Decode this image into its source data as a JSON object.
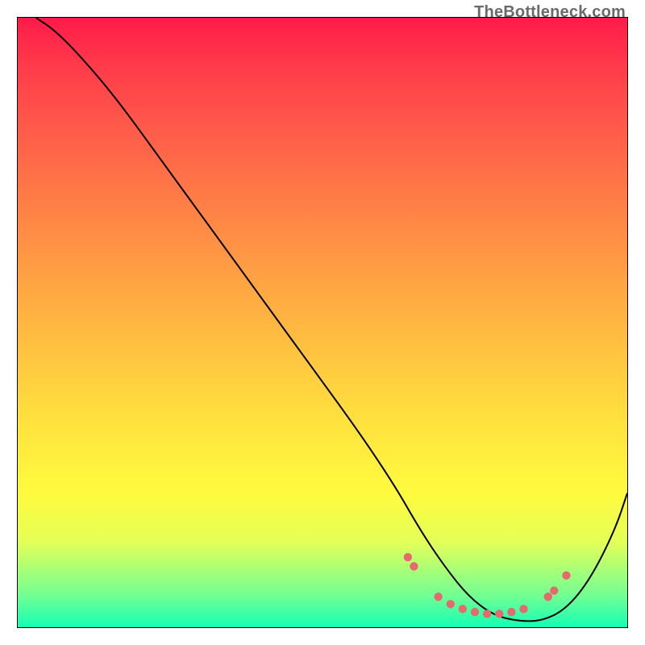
{
  "watermark": "TheBottleneck.com",
  "chart_data": {
    "type": "line",
    "title": "",
    "xlabel": "",
    "ylabel": "",
    "xlim": [
      0,
      100
    ],
    "ylim": [
      0,
      100
    ],
    "grid": false,
    "legend": false,
    "background_gradient": {
      "direction": "vertical",
      "stops": [
        {
          "pos": 0.0,
          "color": "#ff1a49"
        },
        {
          "pos": 0.5,
          "color": "#ffc140"
        },
        {
          "pos": 1.0,
          "color": "#13ffb4"
        }
      ]
    },
    "series": [
      {
        "name": "bottleneck-curve",
        "x": [
          3,
          6,
          10,
          16,
          24,
          32,
          40,
          48,
          56,
          62,
          66,
          70,
          74,
          78,
          82,
          86,
          90,
          94,
          98,
          100
        ],
        "y": [
          100,
          98,
          94,
          87,
          76,
          65,
          54,
          43,
          32,
          23,
          16,
          10,
          5,
          2,
          1,
          1,
          3,
          8,
          16,
          22
        ]
      }
    ],
    "highlight_dots": {
      "name": "minimum-region",
      "color": "#e46a6e",
      "points": [
        {
          "x": 64,
          "y": 11.5
        },
        {
          "x": 65,
          "y": 10.0
        },
        {
          "x": 69,
          "y": 5.0
        },
        {
          "x": 71,
          "y": 3.8
        },
        {
          "x": 73,
          "y": 3.0
        },
        {
          "x": 75,
          "y": 2.5
        },
        {
          "x": 77,
          "y": 2.2
        },
        {
          "x": 79,
          "y": 2.2
        },
        {
          "x": 81,
          "y": 2.5
        },
        {
          "x": 83,
          "y": 3.0
        },
        {
          "x": 87,
          "y": 5.0
        },
        {
          "x": 88,
          "y": 6.0
        },
        {
          "x": 90,
          "y": 8.5
        }
      ]
    }
  }
}
